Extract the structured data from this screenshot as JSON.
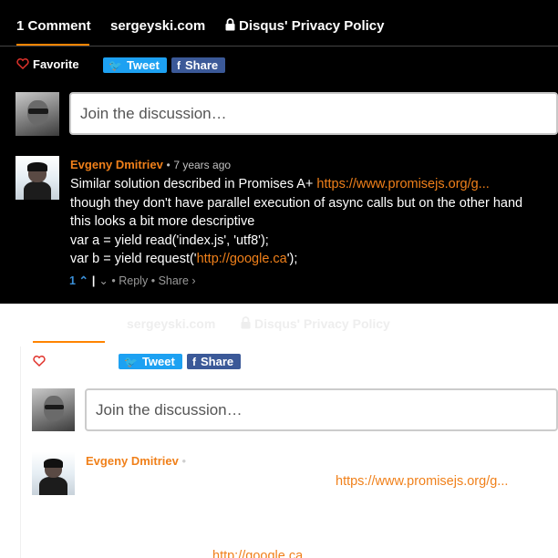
{
  "nav": {
    "comments_tab": "1 Comment",
    "site_tab": "sergeyski.com",
    "privacy_tab": "Disqus' Privacy Policy"
  },
  "actions": {
    "favorite": "Favorite",
    "tweet": "Tweet",
    "share": "Share"
  },
  "composer": {
    "placeholder": "Join the discussion…"
  },
  "comment": {
    "author": "Evgeny Dmitriev",
    "separator": "•",
    "time": "7 years ago",
    "line1_text": "Similar solution described in Promises A+ ",
    "line1_link": "https://www.promisejs.org/g...",
    "line2": "though they don't have parallel execution of async calls but on the other hand",
    "line3": "this looks a bit more descriptive",
    "line4": "var a = yield read('index.js', 'utf8');",
    "line5_pre": "var b = yield request('",
    "line5_link": "http://google.ca",
    "line5_post": "');",
    "upvotes": "1",
    "reply": "Reply",
    "share": "Share ›"
  },
  "ghost": {
    "site_tab": "sergeyski.com",
    "privacy_tab": "Disqus' Privacy Policy",
    "tweet": "Tweet",
    "share": "Share",
    "placeholder": "Join the discussion…",
    "author": "Evgeny Dmitriev",
    "separator": "•",
    "link1": "https://www.promisejs.org/g...",
    "link2": "http://google.ca"
  },
  "colors": {
    "accent": "#ff8400",
    "tweet": "#1da1f2",
    "share": "#3b5998",
    "upvote": "#3a8fd8"
  }
}
